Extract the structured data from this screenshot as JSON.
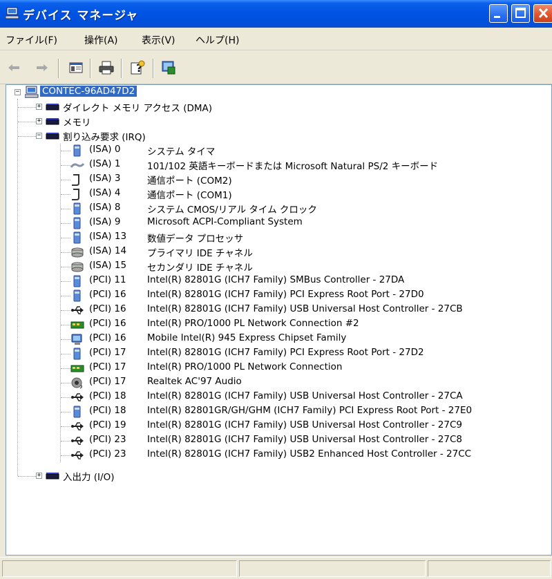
{
  "window": {
    "title": "デバイス マネージャ"
  },
  "menu": [
    "ファイル(F)",
    "操作(A)",
    "表示(V)",
    "ヘルプ(H)"
  ],
  "tree": {
    "root": "CONTEC-96AD47D2",
    "categories": [
      {
        "label": "ダイレクト メモリ アクセス (DMA)",
        "expander": "+"
      },
      {
        "label": "メモリ",
        "expander": "+"
      },
      {
        "label": "割り込み要求 (IRQ)",
        "expander": "−"
      }
    ],
    "irq_items": [
      {
        "irq": "(ISA) 0",
        "device": "システム タイマ",
        "icon": "system-icon"
      },
      {
        "irq": "(ISA) 1",
        "device": "101/102 英語キーボードまたは Microsoft Natural PS/2 キーボード",
        "icon": "keyboard-icon"
      },
      {
        "irq": "(ISA) 3",
        "device": "通信ポート (COM2)",
        "icon": "port-icon"
      },
      {
        "irq": "(ISA) 4",
        "device": "通信ポート (COM1)",
        "icon": "port-icon"
      },
      {
        "irq": "(ISA) 8",
        "device": "システム CMOS/リアル タイム クロック",
        "icon": "system-icon"
      },
      {
        "irq": "(ISA) 9",
        "device": "Microsoft ACPI-Compliant System",
        "icon": "system-icon"
      },
      {
        "irq": "(ISA) 13",
        "device": "数値データ プロセッサ",
        "icon": "system-icon"
      },
      {
        "irq": "(ISA) 14",
        "device": "プライマリ IDE チャネル",
        "icon": "ide-icon"
      },
      {
        "irq": "(ISA) 15",
        "device": "セカンダリ IDE チャネル",
        "icon": "ide-icon"
      },
      {
        "irq": "(PCI) 11",
        "device": "Intel(R) 82801G (ICH7 Family) SMBus Controller - 27DA",
        "icon": "system-icon"
      },
      {
        "irq": "(PCI) 16",
        "device": "Intel(R) 82801G (ICH7 Family) PCI Express Root Port - 27D0",
        "icon": "system-icon"
      },
      {
        "irq": "(PCI) 16",
        "device": "Intel(R) 82801G (ICH7 Family) USB Universal Host Controller - 27CB",
        "icon": "usb-icon"
      },
      {
        "irq": "(PCI) 16",
        "device": "Intel(R) PRO/1000 PL Network Connection #2",
        "icon": "network-icon"
      },
      {
        "irq": "(PCI) 16",
        "device": "Mobile Intel(R) 945 Express Chipset Family",
        "icon": "display-icon"
      },
      {
        "irq": "(PCI) 17",
        "device": "Intel(R) 82801G (ICH7 Family) PCI Express Root Port - 27D2",
        "icon": "system-icon"
      },
      {
        "irq": "(PCI) 17",
        "device": "Intel(R) PRO/1000 PL Network Connection",
        "icon": "network-icon"
      },
      {
        "irq": "(PCI) 17",
        "device": "Realtek AC'97 Audio",
        "icon": "audio-icon"
      },
      {
        "irq": "(PCI) 18",
        "device": "Intel(R) 82801G (ICH7 Family) USB Universal Host Controller - 27CA",
        "icon": "usb-icon"
      },
      {
        "irq": "(PCI) 18",
        "device": "Intel(R) 82801GR/GH/GHM (ICH7 Family) PCI Express Root Port - 27E0",
        "icon": "system-icon"
      },
      {
        "irq": "(PCI) 19",
        "device": "Intel(R) 82801G (ICH7 Family) USB Universal Host Controller - 27C9",
        "icon": "usb-icon"
      },
      {
        "irq": "(PCI) 23",
        "device": "Intel(R) 82801G (ICH7 Family) USB Universal Host Controller - 27C8",
        "icon": "usb-icon"
      },
      {
        "irq": "(PCI) 23",
        "device": "Intel(R) 82801G (ICH7 Family) USB2 Enhanced Host Controller - 27CC",
        "icon": "usb-icon"
      }
    ],
    "last_category": {
      "label": "入出力 (I/O)",
      "expander": "+"
    }
  },
  "colors": {
    "titlebar": "#0054E3",
    "selection": "#316AC5",
    "window_bg": "#ECE9D8"
  }
}
